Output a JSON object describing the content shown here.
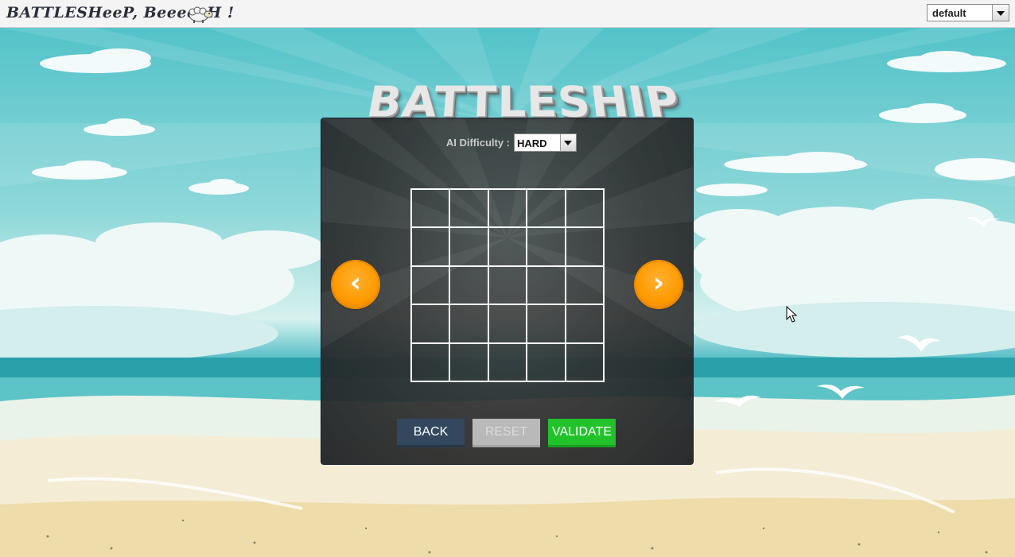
{
  "window": {
    "app_title": "BATTLESHeeP, BeeeeeH !",
    "theme_select": {
      "value": "default"
    }
  },
  "logo": {
    "text": "BATTLESHIP"
  },
  "settings": {
    "difficulty_label": "AI Difficulty :",
    "difficulty_value": "HARD"
  },
  "board": {
    "rows": 5,
    "cols": 5
  },
  "navigation": {
    "prev_icon": "chevron-left-icon",
    "next_icon": "chevron-right-icon"
  },
  "buttons": {
    "back": "BACK",
    "reset": "RESET",
    "validate": "VALIDATE"
  },
  "colors": {
    "accent_orange": "#ff9a00",
    "validate_green": "#22c22a",
    "back_navy": "#33485f",
    "reset_disabled": "#b9b9b9"
  }
}
